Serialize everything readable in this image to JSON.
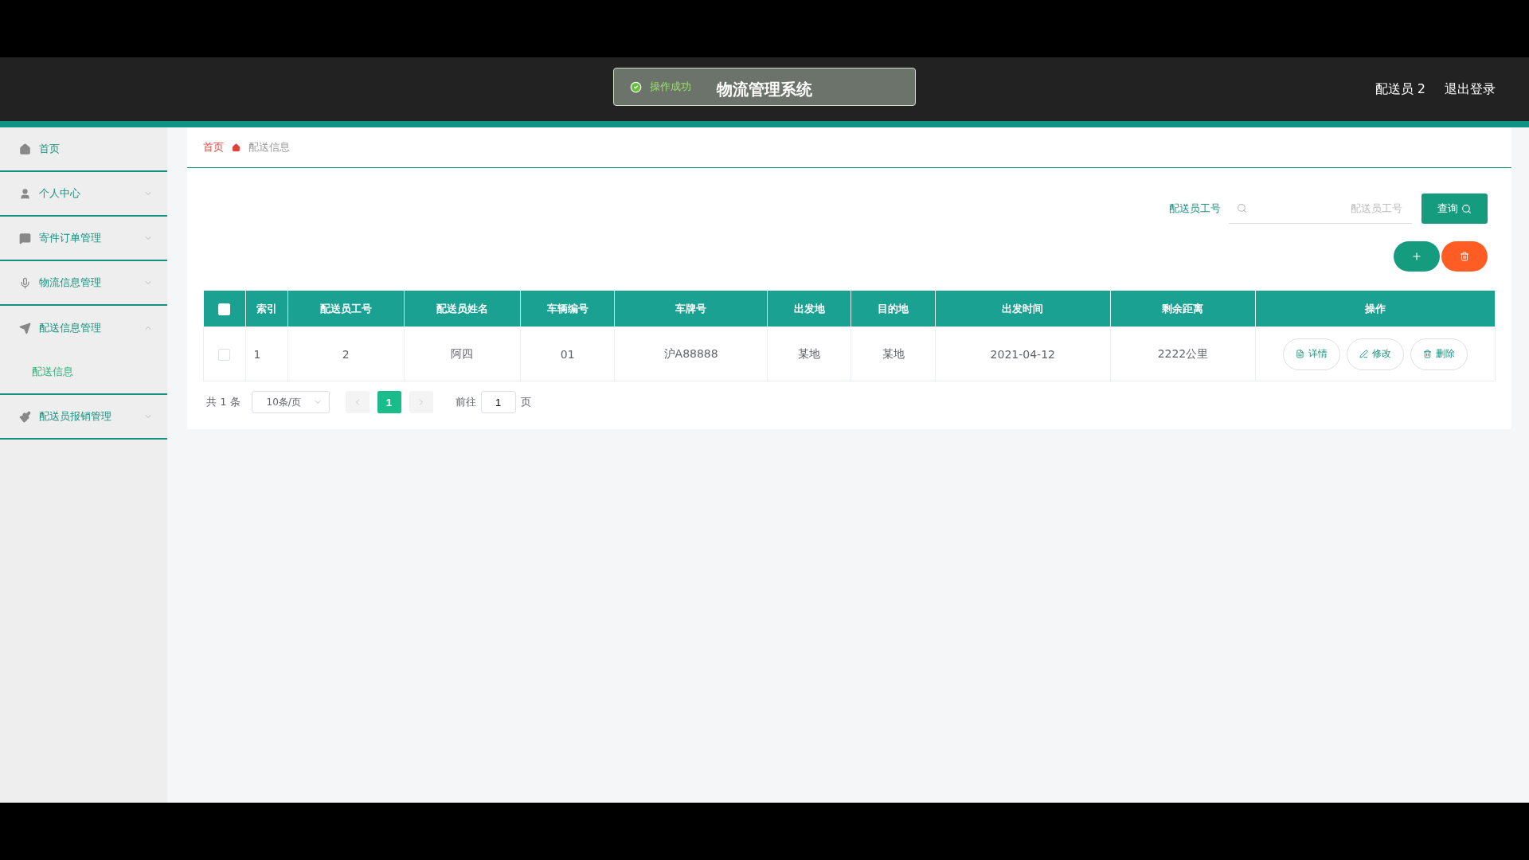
{
  "header": {
    "title": "物流管理系统",
    "user": "配送员 2",
    "logout": "退出登录"
  },
  "toast": {
    "kind": "success",
    "message": "操作成功"
  },
  "sidebar": {
    "items": [
      {
        "label": "首页",
        "kind": "link"
      },
      {
        "label": "个人中心",
        "kind": "menu",
        "expanded": false
      },
      {
        "label": "寄件订单管理",
        "kind": "menu",
        "expanded": false
      },
      {
        "label": "物流信息管理",
        "kind": "menu",
        "expanded": false
      },
      {
        "label": "配送信息管理",
        "kind": "menu",
        "expanded": true,
        "children": [
          {
            "label": "配送信息",
            "selected": true
          }
        ]
      },
      {
        "label": "配送员报销管理",
        "kind": "menu",
        "expanded": false
      }
    ]
  },
  "breadcrumb": [
    {
      "label": "首页"
    },
    {
      "label": "配送信息"
    }
  ],
  "search": {
    "label": "配送员工号",
    "placeholder": "配送员工号",
    "button": "查询"
  },
  "table": {
    "select_all_checked": false,
    "columns": [
      "索引",
      "配送员工号",
      "配送员姓名",
      "车辆编号",
      "车牌号",
      "出发地",
      "目的地",
      "出发时间",
      "剩余距离",
      "操作"
    ],
    "rows": [
      {
        "checked": false,
        "cells": [
          "1",
          "2",
          "阿四",
          "01",
          "沪A88888",
          "某地",
          "某地",
          "2021-04-12",
          "2222公里"
        ],
        "actions": [
          {
            "kind": "detail",
            "label": "详情"
          },
          {
            "kind": "edit",
            "label": "修改"
          },
          {
            "kind": "delete",
            "label": "删除"
          }
        ]
      }
    ]
  },
  "pagination": {
    "total": "共 1 条",
    "page_size": "10条/页",
    "pages": [
      {
        "label": "1",
        "selected": true
      }
    ],
    "goto_label": "前往",
    "goto_value": "1",
    "page_suffix": "页"
  }
}
